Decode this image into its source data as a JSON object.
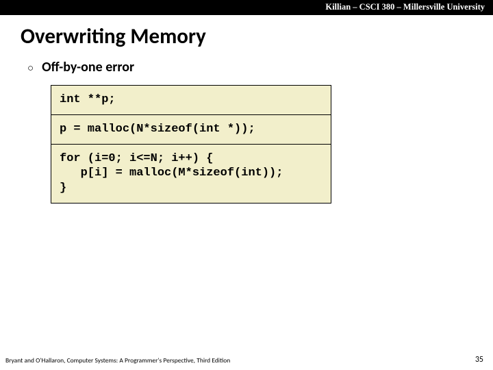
{
  "header": {
    "text": "Killian – CSCI 380 – Millersville University"
  },
  "title": "Overwriting Memory",
  "bullet": {
    "label": "Off-by-one error"
  },
  "code": {
    "line1": "int **p;",
    "line2": "p = malloc(N*sizeof(int *));",
    "line3": "for (i=0; i<=N; i++) {\n   p[i] = malloc(M*sizeof(int));\n}"
  },
  "footer": {
    "left": "Bryant and O'Hallaron, Computer Systems: A Programmer's Perspective, Third Edition",
    "page": "35"
  }
}
